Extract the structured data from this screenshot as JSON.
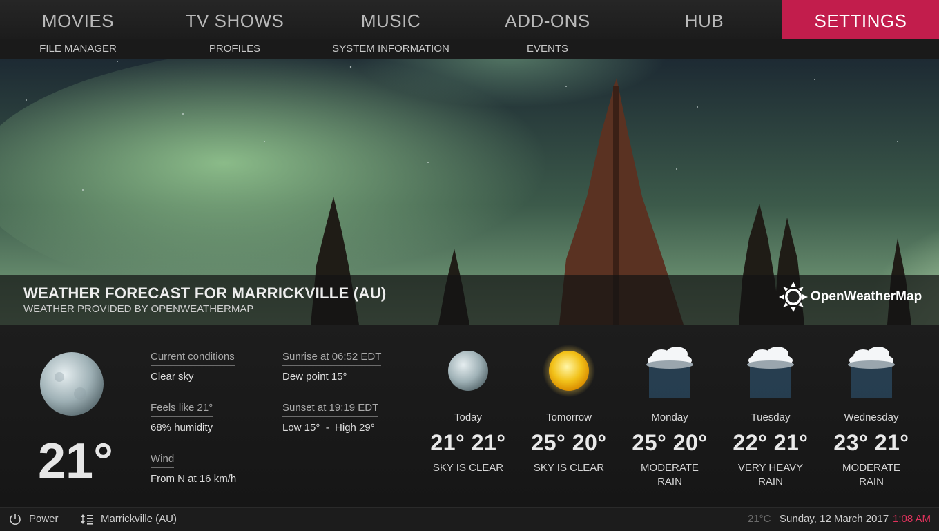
{
  "nav": {
    "items": [
      "MOVIES",
      "TV SHOWS",
      "MUSIC",
      "ADD-ONS",
      "HUB",
      "SETTINGS"
    ],
    "active": "SETTINGS",
    "active_color": "#c21d4c"
  },
  "subnav": {
    "items": [
      "FILE MANAGER",
      "PROFILES",
      "SYSTEM INFORMATION",
      "EVENTS"
    ]
  },
  "hero": {
    "title": "WEATHER FORECAST FOR MARRICKVILLE (AU)",
    "subtitle": "WEATHER PROVIDED BY OPENWEATHERMAP",
    "logo_text": "OpenWeatherMap"
  },
  "current": {
    "icon": "moon-icon",
    "temp": "21°",
    "conditions_label": "Current conditions",
    "conditions_value": "Clear sky",
    "feels_label": "Feels like 21°",
    "humidity": "68% humidity",
    "wind_label": "Wind",
    "wind_value": "From N at 16 km/h",
    "sunrise_label": "Sunrise at 06:52 EDT",
    "dew_point": "Dew point 15°",
    "sunset_label": "Sunset at 19:19 EDT",
    "low_high": "Low 15°  -  High 29°"
  },
  "forecast": [
    {
      "day": "Today",
      "temps": "21° 21°",
      "condition": "SKY IS CLEAR",
      "icon": "moon-icon"
    },
    {
      "day": "Tomorrow",
      "temps": "25° 20°",
      "condition": "SKY IS CLEAR",
      "icon": "sun-icon"
    },
    {
      "day": "Monday",
      "temps": "25° 20°",
      "condition": "MODERATE\nRAIN",
      "icon": "rain-cloud-icon"
    },
    {
      "day": "Tuesday",
      "temps": "22° 21°",
      "condition": "VERY HEAVY\nRAIN",
      "icon": "rain-cloud-icon"
    },
    {
      "day": "Wednesday",
      "temps": "23° 21°",
      "condition": "MODERATE\nRAIN",
      "icon": "rain-cloud-icon"
    }
  ],
  "footer": {
    "power_label": "Power",
    "location": "Marrickville (AU)",
    "temp": "21°C",
    "date": "Sunday, 12 March 2017",
    "time": "1:08 AM",
    "time_color": "#e0325c"
  }
}
